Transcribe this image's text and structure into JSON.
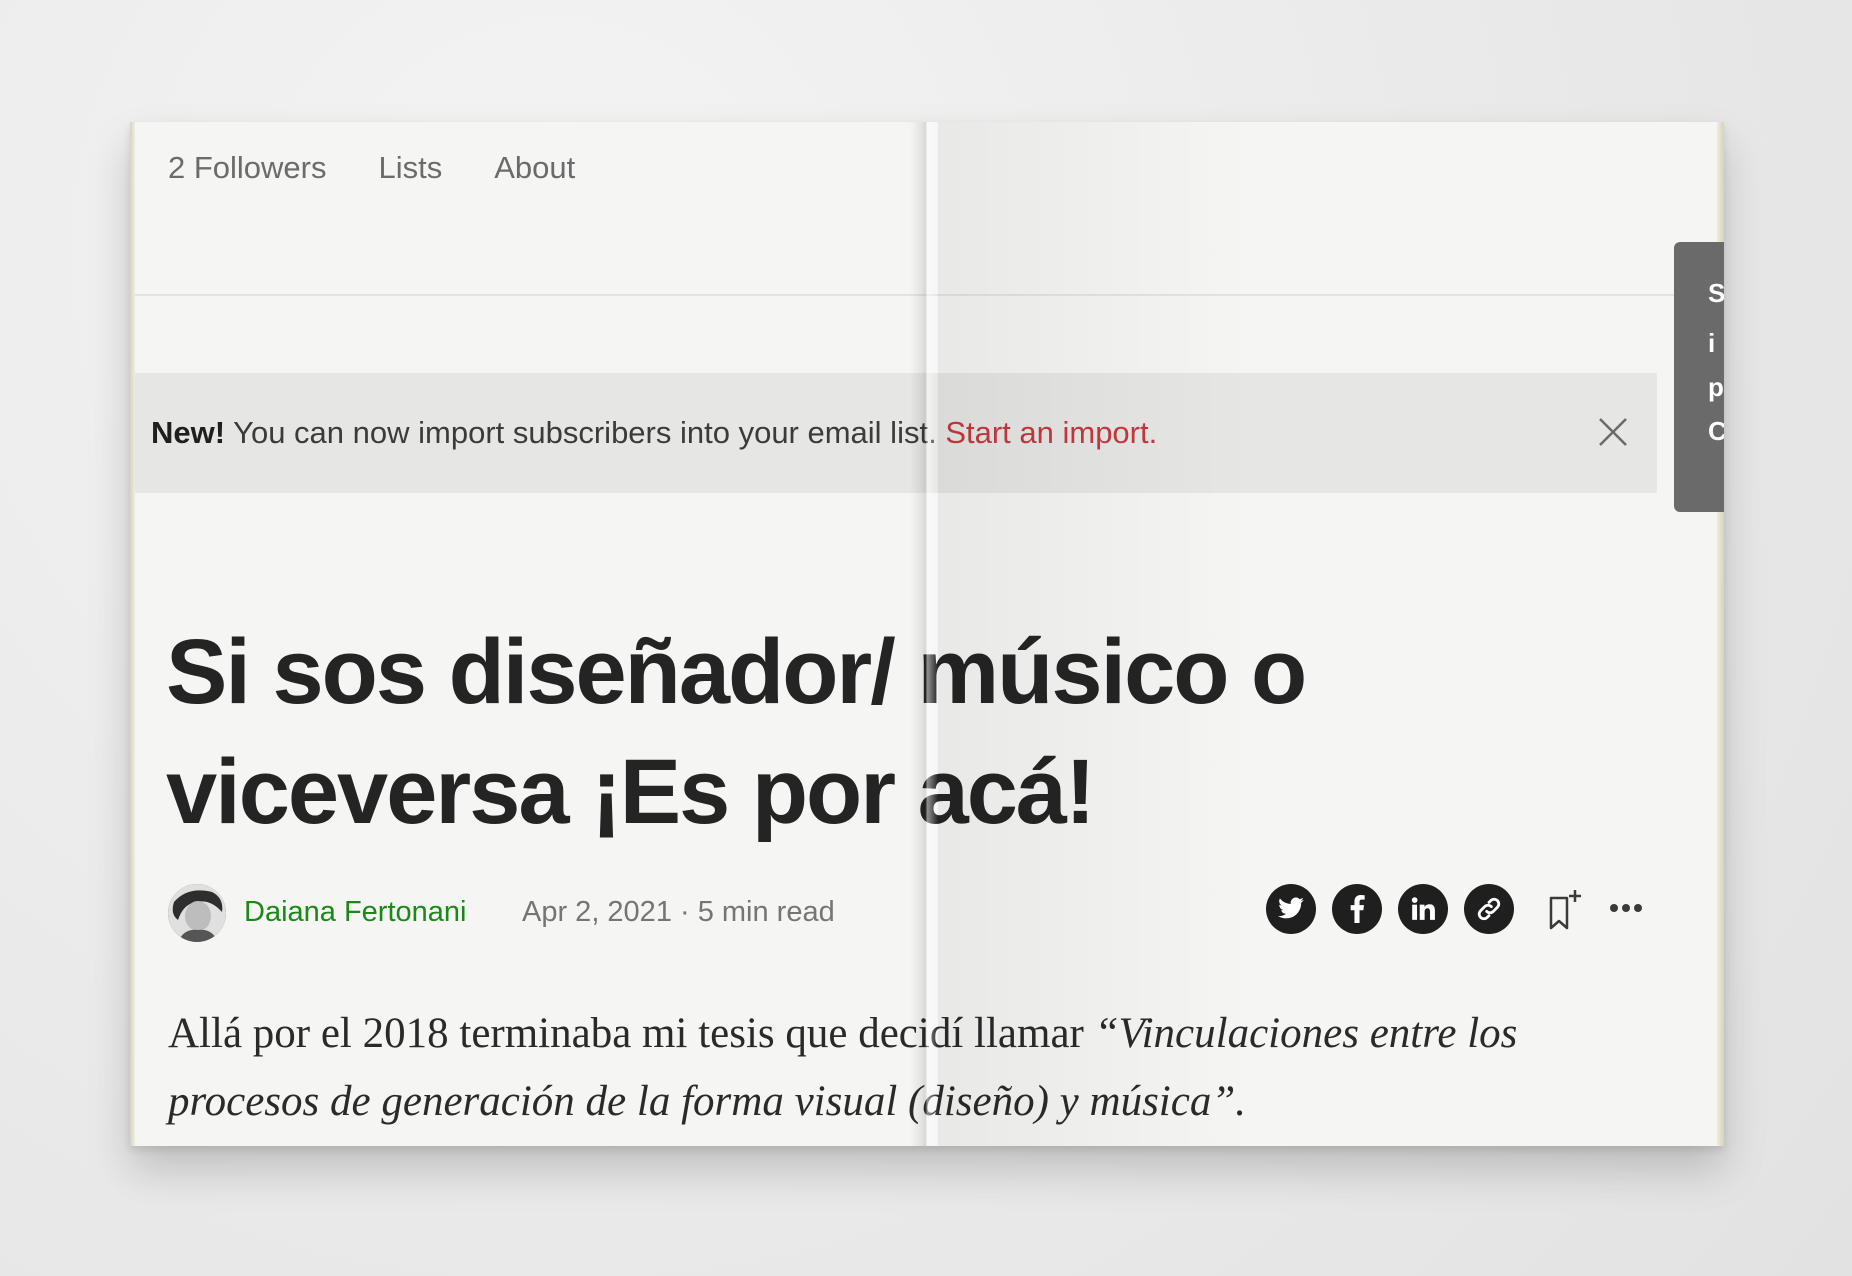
{
  "nav": {
    "followers": "2 Followers",
    "lists": "Lists",
    "about": "About"
  },
  "banner": {
    "new_label": "New!",
    "message": " You can now import subscribers into your email list. ",
    "link": "Start an import."
  },
  "side_tab": {
    "letters": [
      "S",
      "i",
      "p",
      "C"
    ]
  },
  "article": {
    "title": "Si sos diseñador/ músico o viceversa ¡Es por acá!",
    "author": "Daiana Fertonani",
    "date_meta": "Apr 2, 2021 · 5 min read",
    "body_plain": "Allá por el 2018 terminaba mi tesis que decidí llamar ",
    "body_italic": "“Vinculaciones entre los procesos de generación de la forma visual (diseño) y música”."
  },
  "share": {
    "icons": [
      "twitter-icon",
      "facebook-icon",
      "linkedin-icon",
      "link-icon"
    ]
  },
  "colors": {
    "author_green": "#1a8917",
    "banner_link_red": "#c4383e",
    "title": "#242424"
  }
}
